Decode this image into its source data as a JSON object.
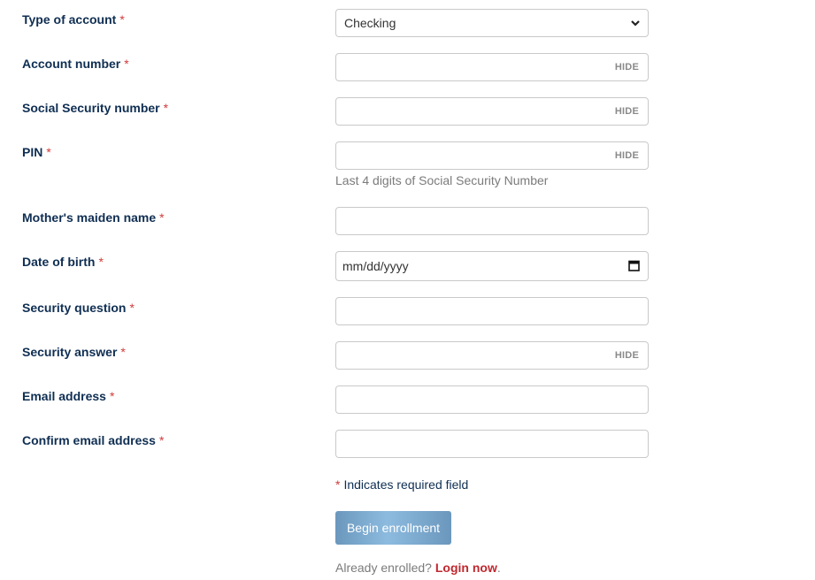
{
  "form": {
    "fields": [
      {
        "id": "account_type",
        "label": "Type of account",
        "required_mark": "*",
        "type": "select",
        "value": "Checking",
        "icon": "chevron-down-icon"
      },
      {
        "id": "account_number",
        "label": "Account number",
        "required_mark": "*",
        "type": "password",
        "value": "",
        "toggle_label": "HIDE"
      },
      {
        "id": "ssn",
        "label": "Social Security number",
        "required_mark": "*",
        "type": "password",
        "value": "",
        "toggle_label": "HIDE"
      },
      {
        "id": "pin",
        "label": "PIN",
        "required_mark": "*",
        "type": "password",
        "value": "",
        "toggle_label": "HIDE",
        "helper": "Last 4 digits of Social Security Number"
      },
      {
        "id": "maiden_name",
        "label": "Mother's maiden name",
        "required_mark": "*",
        "type": "text",
        "value": ""
      },
      {
        "id": "dob",
        "label": "Date of birth",
        "required_mark": "*",
        "type": "date",
        "placeholder": "mm/dd/yyyy",
        "icon": "calendar-icon"
      },
      {
        "id": "security_question",
        "label": "Security question",
        "required_mark": "*",
        "type": "text",
        "value": ""
      },
      {
        "id": "security_answer",
        "label": "Security answer",
        "required_mark": "*",
        "type": "password",
        "value": "",
        "toggle_label": "HIDE"
      },
      {
        "id": "email",
        "label": "Email address",
        "required_mark": "*",
        "type": "text",
        "value": ""
      },
      {
        "id": "confirm_email",
        "label": "Confirm email address",
        "required_mark": "*",
        "type": "text",
        "value": ""
      }
    ],
    "required_legend": {
      "mark": "*",
      "text": "Indicates required field"
    },
    "submit_label": "Begin enrollment",
    "already_enrolled": {
      "prefix": "Already enrolled?",
      "link_label": "Login now",
      "suffix": "."
    }
  },
  "colors": {
    "label": "#0f2e52",
    "required": "#d23a3a",
    "helper": "#7b7b7b",
    "button": "#7aa6cc",
    "link": "#c0282f"
  }
}
